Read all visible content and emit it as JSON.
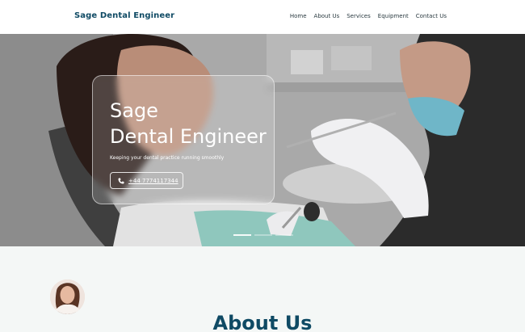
{
  "header": {
    "brand": "Sage Dental Engineer",
    "nav": [
      "Home",
      "About Us",
      "Services",
      "Equipment",
      "Contact Us"
    ]
  },
  "hero": {
    "title_line1": "Sage",
    "title_line2": "Dental Engineer",
    "subtitle": "Keeping your dental practice running smoothly",
    "phone": "+44 7774117344",
    "phone_icon": "phone-icon",
    "slide_count": 3,
    "active_slide": 1
  },
  "about": {
    "title": "About Us"
  },
  "colors": {
    "brand": "#0f4a64",
    "about_bg": "#f4f7f6"
  }
}
